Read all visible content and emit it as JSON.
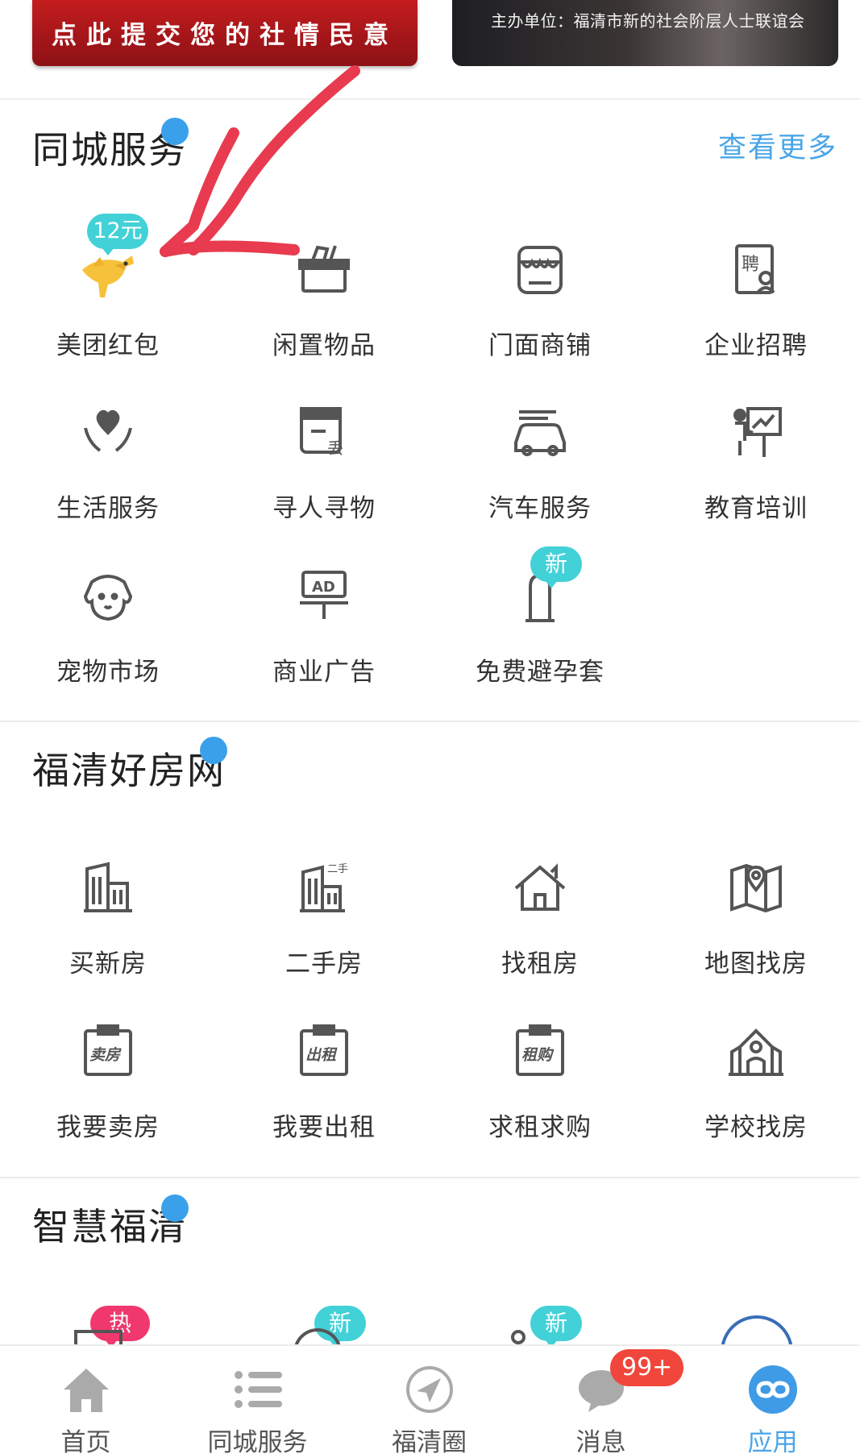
{
  "banners": {
    "left_text": "点此提交您的社情民意",
    "right_text": "主办单位：福清市新的社会阶层人士联谊会"
  },
  "section1": {
    "title": "同城服务",
    "more": "查看更多",
    "items": [
      {
        "label": "美团红包",
        "icon": "meituan-kangaroo-icon",
        "tag": "12元"
      },
      {
        "label": "闲置物品",
        "icon": "idle-box-icon"
      },
      {
        "label": "门面商铺",
        "icon": "storefront-icon"
      },
      {
        "label": "企业招聘",
        "icon": "recruit-icon"
      },
      {
        "label": "生活服务",
        "icon": "heart-hand-icon"
      },
      {
        "label": "寻人寻物",
        "icon": "lost-found-icon"
      },
      {
        "label": "汽车服务",
        "icon": "car-icon"
      },
      {
        "label": "教育培训",
        "icon": "teacher-board-icon"
      },
      {
        "label": "宠物市场",
        "icon": "dog-icon"
      },
      {
        "label": "商业广告",
        "icon": "ad-board-icon"
      },
      {
        "label": "免费避孕套",
        "icon": "condom-icon",
        "tag": "新"
      }
    ]
  },
  "section2": {
    "title": "福清好房网",
    "items": [
      {
        "label": "买新房",
        "icon": "new-building-icon"
      },
      {
        "label": "二手房",
        "icon": "second-hand-building-icon"
      },
      {
        "label": "找租房",
        "icon": "house-icon"
      },
      {
        "label": "地图找房",
        "icon": "map-pin-icon"
      },
      {
        "label": "我要卖房",
        "icon": "sell-clipboard-icon",
        "icon_text": "卖房"
      },
      {
        "label": "我要出租",
        "icon": "rent-out-clipboard-icon",
        "icon_text": "出租"
      },
      {
        "label": "求租求购",
        "icon": "rent-buy-clipboard-icon",
        "icon_text": "租购"
      },
      {
        "label": "学校找房",
        "icon": "school-icon"
      }
    ]
  },
  "section3": {
    "title": "智慧福清",
    "tags": [
      "热",
      "新",
      "新"
    ]
  },
  "bottom_nav": {
    "items": [
      {
        "label": "首页",
        "icon": "home-icon"
      },
      {
        "label": "同城服务",
        "icon": "list-icon"
      },
      {
        "label": "福清圈",
        "icon": "compass-icon"
      },
      {
        "label": "消息",
        "icon": "chat-bubble-icon",
        "badge": "99+"
      },
      {
        "label": "应用",
        "icon": "apps-icon",
        "active": true
      }
    ]
  },
  "colors": {
    "accent": "#4aa5e8",
    "new_tag": "#42d1d7",
    "hot_tag": "#f0386e",
    "badge": "#f0463b",
    "annotation": "#e83b4f"
  }
}
